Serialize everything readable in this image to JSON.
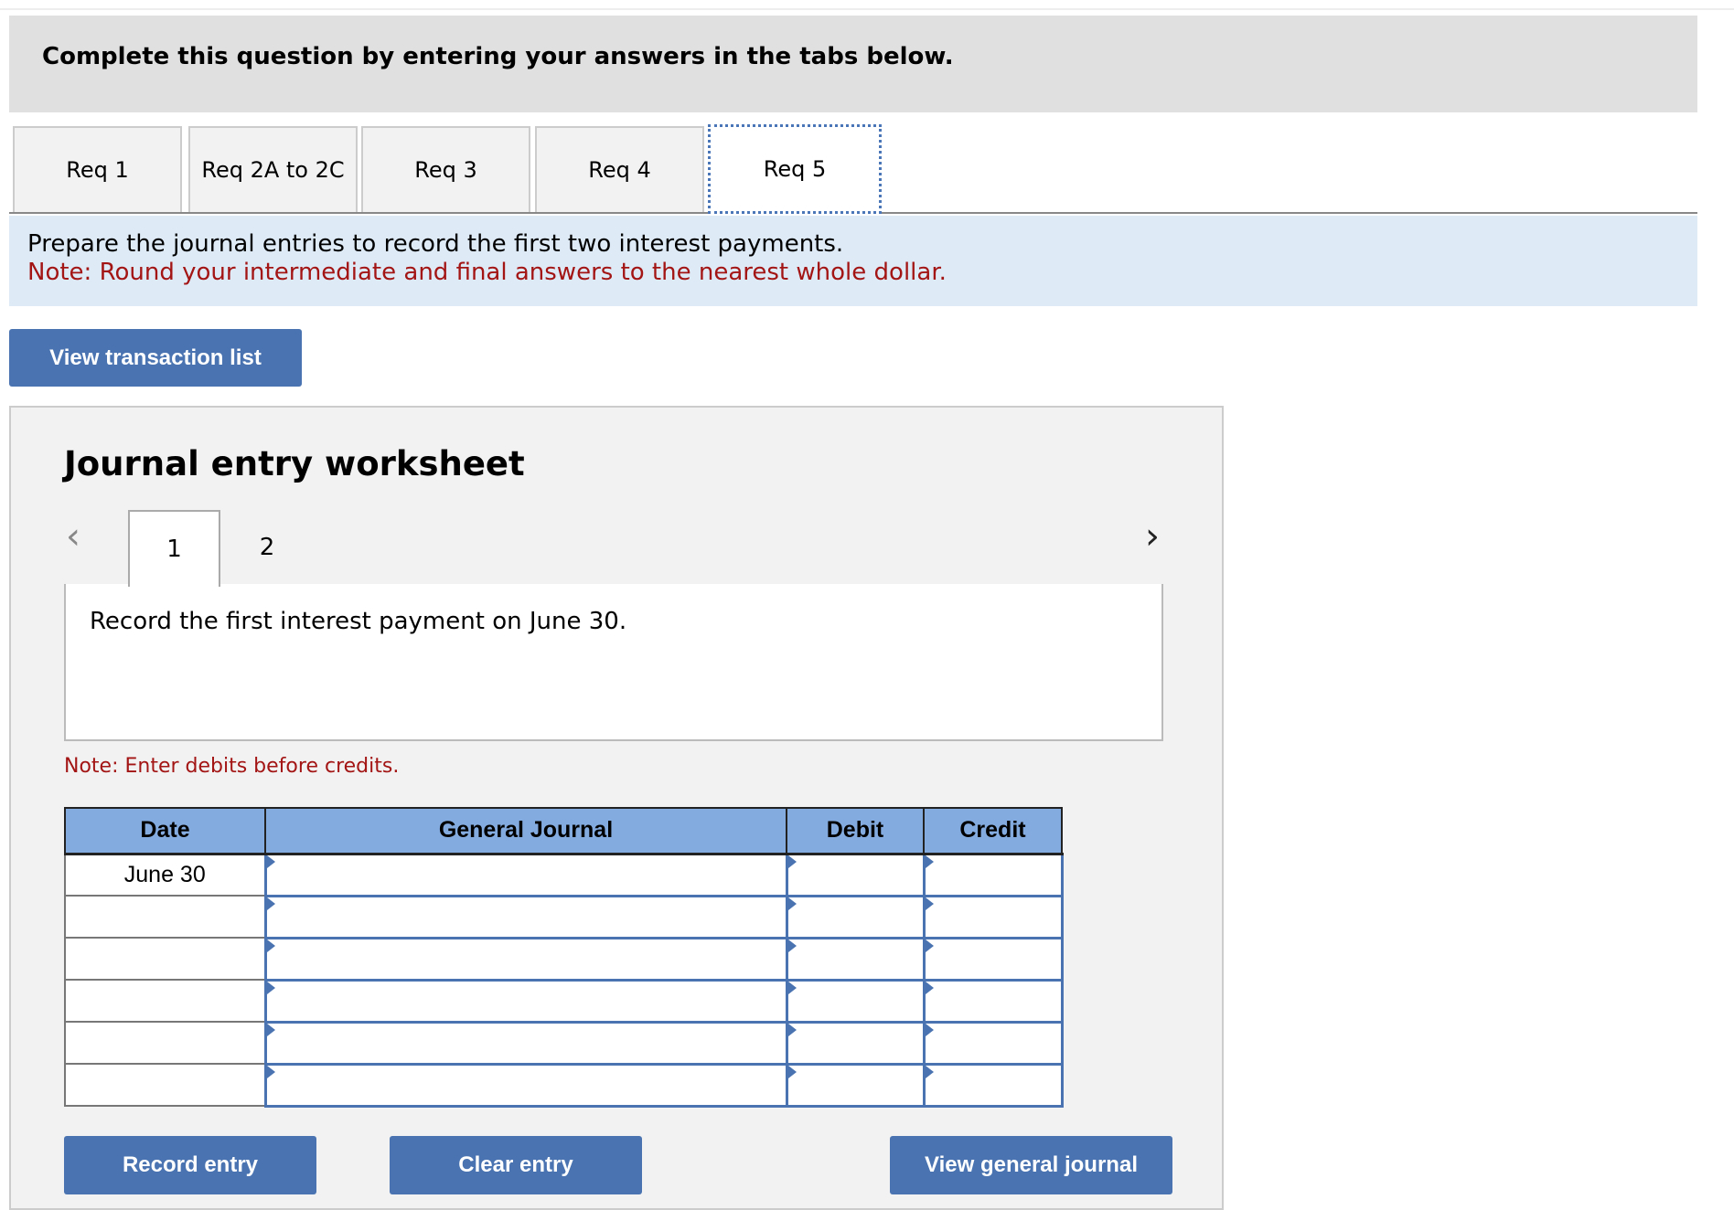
{
  "header": {
    "title": "Complete this question by entering your answers in the tabs below."
  },
  "tabs": [
    {
      "label": "Req 1"
    },
    {
      "label": "Req 2A to 2C"
    },
    {
      "label": "Req 3"
    },
    {
      "label": "Req 4"
    },
    {
      "label": "Req 5",
      "active": true
    }
  ],
  "instructions": {
    "text": "Prepare the journal entries to record the first two interest payments.",
    "note": "Note: Round your intermediate and final answers to the nearest whole dollar."
  },
  "view_transaction_list": "View transaction list",
  "worksheet": {
    "title": "Journal entry worksheet",
    "entry_tabs": [
      "1",
      "2"
    ],
    "active_entry": "1",
    "description": "Record the first interest payment on June 30.",
    "note": "Note: Enter debits before credits.",
    "columns": [
      "Date",
      "General Journal",
      "Debit",
      "Credit"
    ],
    "rows": [
      {
        "date": "June 30"
      },
      {
        "date": ""
      },
      {
        "date": ""
      },
      {
        "date": ""
      },
      {
        "date": ""
      },
      {
        "date": ""
      }
    ],
    "buttons": {
      "record": "Record entry",
      "clear": "Clear entry",
      "view_journal": "View general journal"
    }
  },
  "colors": {
    "accent": "#4a74b1",
    "header_blue": "#84abe0",
    "note_red": "#a31515",
    "instr_bg": "#deebf7"
  }
}
